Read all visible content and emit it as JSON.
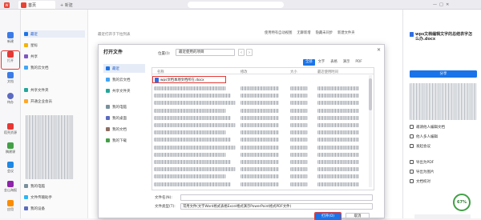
{
  "titlebar": {
    "home_tab": "首页",
    "new_tab": "+ 新建"
  },
  "rail": {
    "items": [
      {
        "label": "新建",
        "color": "#3b7be8"
      },
      {
        "label": "打开",
        "color": "#e53935"
      },
      {
        "label": "文档",
        "color": "#3b7be8"
      },
      {
        "label": "待办",
        "color": "#5c6bc0"
      },
      {
        "label": "稻壳资源",
        "color": "#e53935"
      },
      {
        "label": "稿建课",
        "color": "#43a047"
      },
      {
        "label": "会议",
        "color": "#1e88e5"
      },
      {
        "label": "金山海报",
        "color": "#8e24aa"
      },
      {
        "label": "应用",
        "color": "#fb8c00"
      }
    ]
  },
  "sidebar": {
    "items": [
      "最近",
      "星标",
      "共享",
      "我的云文档",
      "共享文件夹",
      "开通企业会员",
      "我的电脑",
      "文件传输助手",
      "我的设备"
    ]
  },
  "main": {
    "recent_hint": "最近打开于下拉列表",
    "toolbar": [
      "使用特有自动视图",
      "无聊新增",
      "隐藏未同步",
      "新建文件夹"
    ]
  },
  "right_panel": {
    "doc_title": "wps文档编辑文字的总结表字怎么办.docx",
    "share_button": "分享",
    "actions": [
      "邀请他人编辑文档",
      "他人多人编辑",
      "发起会议",
      "导出为PDF",
      "导出为图片",
      "文档校对"
    ],
    "zoom_value": "67%"
  },
  "dialog": {
    "title": "打开文件",
    "location_label": "位置(I):",
    "location_value": "最近使用的项目",
    "nav": [
      "最近",
      "我的云文档",
      "共享文件夹",
      "我的电脑",
      "我的桌面",
      "我的文档",
      "我的下载"
    ],
    "filter_tabs": [
      "全部",
      "文字",
      "表格",
      "演示",
      "PDF"
    ],
    "columns": [
      "名称",
      "修改",
      "大小",
      "最近使用时间"
    ],
    "selected_file": "wps文档本地文档所在.docx",
    "filename_label": "文件名(N):",
    "filename_value": "",
    "filetype_label": "文件类型(T):",
    "filetype_value": "常用文件(文字Word格式表格Excel格式演示PowerPoint格式PDF文件)",
    "open_button": "打开(O)",
    "cancel_button": "取消"
  }
}
